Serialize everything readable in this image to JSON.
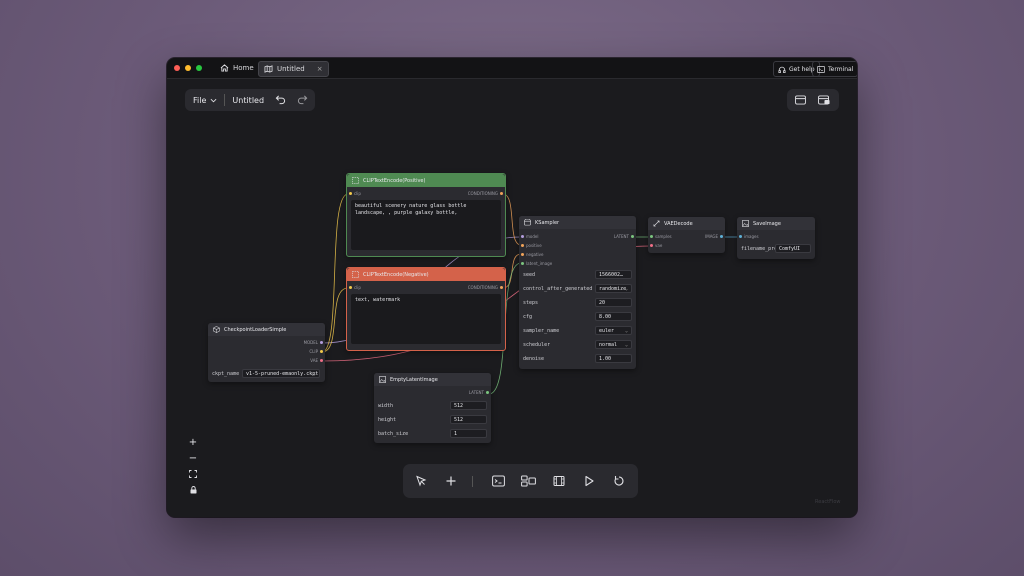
{
  "titlebar": {
    "tabs": [
      {
        "label": "Home",
        "icon": "home-icon"
      },
      {
        "label": "Untitled",
        "icon": "map-icon",
        "close": "×"
      }
    ],
    "help_label": "Get help",
    "terminal_label": "Terminal"
  },
  "toolbar": {
    "file_label": "File",
    "workflow_name": "Untitled"
  },
  "nodes": {
    "positive": {
      "title": "CLIPTextEncode(Positive)",
      "input": "clip",
      "output": "CONDITIONING",
      "text": "beautiful scenery nature glass bottle landscape, , purple galaxy bottle,"
    },
    "negative": {
      "title": "CLIPTextEncode(Negative)",
      "input": "clip",
      "output": "CONDITIONING",
      "text": "text, watermark"
    },
    "checkpoint": {
      "title": "CheckpointLoaderSimple",
      "outputs": [
        "MODEL",
        "CLIP",
        "VAE"
      ],
      "widget_label": "ckpt_name",
      "widget_value": "v1-5-pruned-emaonly.ckpt"
    },
    "latent": {
      "title": "EmptyLatentImage",
      "output": "LATENT",
      "widgets": [
        {
          "label": "width",
          "value": "512"
        },
        {
          "label": "height",
          "value": "512"
        },
        {
          "label": "batch_size",
          "value": "1"
        }
      ]
    },
    "ksampler": {
      "title": "KSampler",
      "inputs": [
        "model",
        "positive",
        "negative",
        "latent_image"
      ],
      "output": "LATENT",
      "widgets": [
        {
          "label": "seed",
          "value": "1566002…"
        },
        {
          "label": "control_after_generated",
          "value": "randomize"
        },
        {
          "label": "steps",
          "value": "20"
        },
        {
          "label": "cfg",
          "value": "8.00"
        },
        {
          "label": "sampler_name",
          "value": "euler"
        },
        {
          "label": "scheduler",
          "value": "normal"
        },
        {
          "label": "denoise",
          "value": "1.00"
        }
      ]
    },
    "vaedecode": {
      "title": "VAEDecode",
      "inputs": [
        "samples",
        "vae"
      ],
      "output": "IMAGE"
    },
    "saveimage": {
      "title": "SaveImage",
      "input": "images",
      "widget_label": "filename_pre",
      "widget_value": "ComfyUI"
    }
  },
  "zoom_controls": {
    "zoom_in": "+",
    "zoom_out": "−"
  },
  "watermark": "ReactFlow",
  "colors": {
    "positive_header": "#4f8a52",
    "negative_header": "#d4624a",
    "model_wire": "#b39ddb",
    "clip_wire": "#f2c94c",
    "vae_wire": "#ef6f86",
    "conditioning_wire": "#f0a35a",
    "latent_wire": "#7bc47f"
  }
}
